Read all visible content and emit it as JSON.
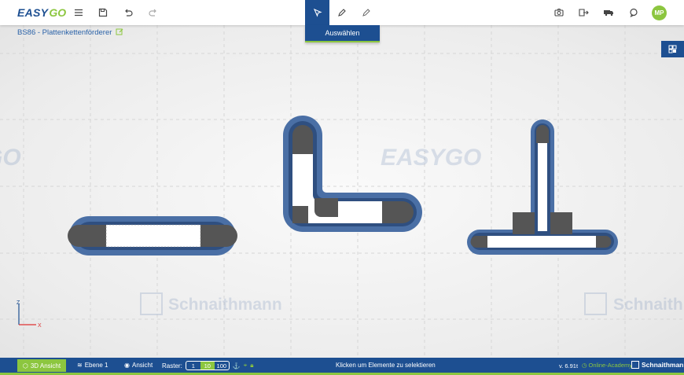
{
  "app": {
    "logo_text": "EASY",
    "logo_go": "GO",
    "project_title": "BS86 - Plattenkettenförderer"
  },
  "toolbar": {
    "icons": [
      "menu-icon",
      "save-icon",
      "undo-icon",
      "redo-icon"
    ],
    "modes": [
      "select-cursor-icon",
      "pencil-icon",
      "edit-pen-icon"
    ],
    "active_mode": "select-cursor-icon",
    "active_mode_label": "Auswählen",
    "right_icons": [
      "camera-icon",
      "export-icon",
      "truck-icon",
      "chat-icon"
    ],
    "avatar_initials": "MP"
  },
  "canvas": {
    "watermark_main": "EASYGO",
    "watermark_brand": "Schnaithmann",
    "axis_z": "Z",
    "axis_x": "X"
  },
  "bottom": {
    "view_3d_label": "3D Ansicht",
    "layer_label": "Ebene 1",
    "view_label": "Ansicht",
    "raster_label": "Raster:",
    "raster_options": [
      "1",
      "10",
      "100"
    ],
    "raster_selected": "10",
    "status_message": "Klicken um Elemente zu selektieren",
    "version": "v. 6.91t",
    "academy_label": "Online-Academy",
    "brand": "Schnaithmann"
  },
  "colors": {
    "primary": "#1d4f91",
    "accent": "#8cc63f",
    "conveyor": "#4a6fa5",
    "drive": "#555555"
  }
}
